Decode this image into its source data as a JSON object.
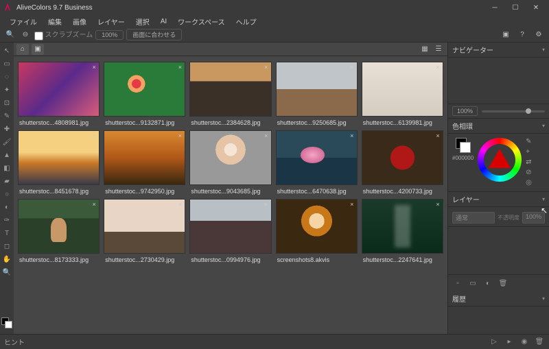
{
  "window": {
    "title": "AliveColors 9.7 Business"
  },
  "menu": {
    "items": [
      "ファイル",
      "編集",
      "画像",
      "レイヤー",
      "選択",
      "AI",
      "ワークスペース",
      "ヘルプ"
    ]
  },
  "toolbar": {
    "scrub_zoom": "スクラブズーム",
    "pct100": "100%",
    "fit": "画面に合わせる"
  },
  "panels": {
    "navigator": "ナビゲーター",
    "color": "色相環",
    "layers": "レイヤー",
    "history": "履歴",
    "zoom_pct": "100%",
    "hex": "#000000",
    "blend": "通常",
    "opacity_label": "不透明度",
    "opacity_val": "100%"
  },
  "hint": "ヒント",
  "files": [
    {
      "name": "shutterstoc...4808981.jpg",
      "cls": "t1"
    },
    {
      "name": "shutterstoc...9132871.jpg",
      "cls": "t2"
    },
    {
      "name": "shutterstoc...2384628.jpg",
      "cls": "t3"
    },
    {
      "name": "shutterstoc...9250685.jpg",
      "cls": "t4"
    },
    {
      "name": "shutterstoc...6139981.jpg",
      "cls": "t5"
    },
    {
      "name": "shutterstoc...8451678.jpg",
      "cls": "t6"
    },
    {
      "name": "shutterstoc...9742950.jpg",
      "cls": "t7"
    },
    {
      "name": "shutterstoc...9043685.jpg",
      "cls": "t8"
    },
    {
      "name": "shutterstoc...6470638.jpg",
      "cls": "t9"
    },
    {
      "name": "shutterstoc...4200733.jpg",
      "cls": "t10"
    },
    {
      "name": "shutterstoc...8173333.jpg",
      "cls": "t11"
    },
    {
      "name": "shutterstoc...2730429.jpg",
      "cls": "t12"
    },
    {
      "name": "shutterstoc...0994976.jpg",
      "cls": "t13"
    },
    {
      "name": "screenshots8.akvis",
      "cls": "t14"
    },
    {
      "name": "shutterstoc...2247641.jpg",
      "cls": "t15"
    }
  ]
}
